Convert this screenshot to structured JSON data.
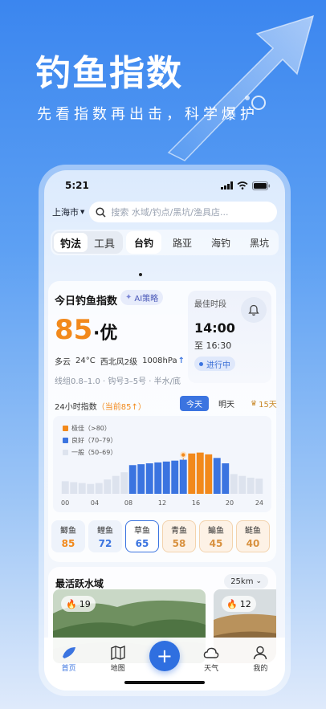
{
  "hero": {
    "title": "钓鱼指数",
    "subtitle": "先看指数再出击，科学爆护"
  },
  "status_bar": {
    "time": "5:21"
  },
  "search": {
    "city": "上海市",
    "placeholder": "搜索 水域/钓点/黑坑/渔具店..."
  },
  "segment": {
    "items": [
      "钓法",
      "工具"
    ],
    "active": 0
  },
  "categories": {
    "items": [
      "台钓",
      "路亚",
      "海钓",
      "黑坑"
    ],
    "active": 0
  },
  "index_card": {
    "title": "今日钓鱼指数",
    "ai_label": "AI策略",
    "score": "85",
    "level": "·优",
    "weather": [
      "多云",
      "24°C",
      "西北风2级",
      "1008hPa"
    ],
    "tackle": "线组0.8–1.0 · 钩号3–5号 · 半水/底",
    "best_time": {
      "label": "最佳时段",
      "start": "14:00",
      "end": "至 16:30",
      "status": "进行中"
    },
    "hourly_label": "24小时指数",
    "hourly_current": "（当前85↑）",
    "day_tabs": [
      "今天",
      "明天",
      "15天"
    ],
    "vip_icon": "vip-crown-icon"
  },
  "chart_data": {
    "type": "bar",
    "legend": [
      {
        "label": "极佳（>80）",
        "color": "#f2891b"
      },
      {
        "label": "良好（70–79）",
        "color": "#3b74e0"
      },
      {
        "label": "一般（50–69）",
        "color": "#dde3ee"
      }
    ],
    "x_ticks": [
      "00",
      "04",
      "08",
      "12",
      "16",
      "20",
      "24"
    ],
    "hours": [
      0,
      1,
      2,
      3,
      4,
      5,
      6,
      7,
      8,
      9,
      10,
      11,
      12,
      13,
      14,
      15,
      16,
      17,
      18,
      19,
      20,
      21,
      22,
      23
    ],
    "values": [
      54,
      53,
      52,
      51,
      52,
      56,
      60,
      64,
      72,
      73,
      74,
      75,
      76,
      77,
      78,
      85,
      86,
      84,
      80,
      74,
      62,
      60,
      58,
      57
    ],
    "current_hour": 14,
    "ylim": [
      40,
      100
    ]
  },
  "fish": [
    {
      "name": "鲫鱼",
      "value": "85",
      "style": "orange"
    },
    {
      "name": "鲤鱼",
      "value": "72",
      "style": "blue"
    },
    {
      "name": "草鱼",
      "value": "65",
      "style": "selected"
    },
    {
      "name": "青鱼",
      "value": "58",
      "style": "warm"
    },
    {
      "name": "鳊鱼",
      "value": "45",
      "style": "warm"
    },
    {
      "name": "鲢鱼",
      "value": "40",
      "style": "warm"
    }
  ],
  "active_waters": {
    "title": "最活跃水域",
    "range": "25km",
    "spots": [
      {
        "heat": "19"
      },
      {
        "heat": "12"
      }
    ]
  },
  "tabbar": {
    "items": [
      "首页",
      "地图",
      "天气",
      "我的"
    ],
    "fab": "+"
  }
}
